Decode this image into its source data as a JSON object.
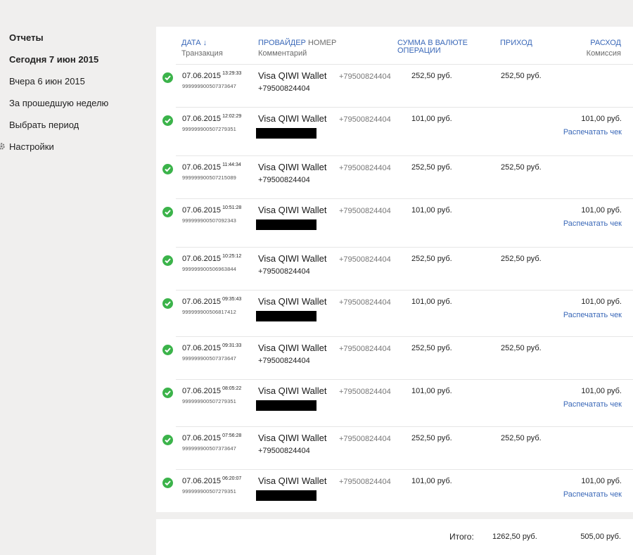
{
  "sidebar": {
    "items": [
      {
        "label": "Отчеты"
      },
      {
        "label": "Сегодня 7 июн 2015"
      },
      {
        "label": "Вчера 6 июн 2015"
      },
      {
        "label": "За прошедшую неделю"
      },
      {
        "label": "Выбрать период"
      },
      {
        "label": "Настройки",
        "icon": "gear-icon"
      }
    ]
  },
  "table": {
    "headers": {
      "date": "ДАТА ↓",
      "transaction": "Транзакция",
      "provider": "ПРОВАЙДЕР",
      "number": "НОМЕР",
      "comment": "Комментарий",
      "amount_line1": "СУММА В ВАЛЮТЕ",
      "amount_line2": "ОПЕРАЦИИ",
      "income": "ПРИХОД",
      "expense": "РАСХОД",
      "commission": "Комиссия"
    },
    "rows": [
      {
        "date": "07.06.2015",
        "time": "13:29:33",
        "txid": "99999990050737364​7",
        "provider": "Visa QIWI Wallet",
        "number": "+79500824404",
        "comment": "+79500824404",
        "amount": "252,50 руб.",
        "income": "252,50 руб.",
        "expense": "",
        "print": ""
      },
      {
        "date": "07.06.2015",
        "time": "12:02:29",
        "txid": "999999900507279351",
        "provider": "Visa QIWI Wallet",
        "number": "+79500824404",
        "comment": "",
        "amount": "101,00 руб.",
        "income": "",
        "expense": "101,00 руб.",
        "print": "Распечатать чек"
      },
      {
        "date": "07.06.2015",
        "time": "11:44:34",
        "txid": "999999900507215089",
        "provider": "Visa QIWI Wallet",
        "number": "+79500824404",
        "comment": "+79500824404",
        "amount": "252,50 руб.",
        "income": "252,50 руб.",
        "expense": "",
        "print": ""
      },
      {
        "date": "07.06.2015",
        "time": "10:51:28",
        "txid": "999999900507092343",
        "provider": "Visa QIWI Wallet",
        "number": "+79500824404",
        "comment": "",
        "amount": "101,00 руб.",
        "income": "",
        "expense": "101,00 руб.",
        "print": "Распечатать чек"
      },
      {
        "date": "07.06.2015",
        "time": "10:25:12",
        "txid": "999999900506963844",
        "provider": "Visa QIWI Wallet",
        "number": "+79500824404",
        "comment": "+79500824404",
        "amount": "252,50 руб.",
        "income": "252,50 руб.",
        "expense": "",
        "print": ""
      },
      {
        "date": "07.06.2015",
        "time": "09:35:43",
        "txid": "999999900506817412",
        "provider": "Visa QIWI Wallet",
        "number": "+79500824404",
        "comment": "",
        "amount": "101,00 руб.",
        "income": "",
        "expense": "101,00 руб.",
        "print": "Распечатать чек"
      },
      {
        "date": "07.06.2015",
        "time": "09:31:33",
        "txid": "999999900507373647",
        "provider": "Visa QIWI Wallet",
        "number": "+79500824404",
        "comment": "+79500824404",
        "amount": "252,50 руб.",
        "income": "252,50 руб.",
        "expense": "",
        "print": ""
      },
      {
        "date": "07.06.2015",
        "time": "08:05:22",
        "txid": "999999900507279351",
        "provider": "Visa QIWI Wallet",
        "number": "+79500824404",
        "comment": "",
        "amount": "101,00 руб.",
        "income": "",
        "expense": "101,00 руб.",
        "print": "Распечатать чек"
      },
      {
        "date": "07.06.2015",
        "time": "07:56:28",
        "txid": "999999900507373647",
        "provider": "Visa QIWI Wallet",
        "number": "+79500824404",
        "comment": "+79500824404",
        "amount": "252,50 руб.",
        "income": "252,50 руб.",
        "expense": "",
        "print": ""
      },
      {
        "date": "07.06.2015",
        "time": "06:20:07",
        "txid": "999999900507279351",
        "provider": "Visa QIWI Wallet",
        "number": "+79500824404",
        "comment": "",
        "amount": "101,00 руб.",
        "income": "",
        "expense": "101,00 руб.",
        "print": "Распечатать чек"
      }
    ]
  },
  "totals": {
    "label": "Итого:",
    "income": "1262,50 руб.",
    "expense": "505,00 руб."
  },
  "colors": {
    "accent": "#3a68b8",
    "success": "#3bb34a",
    "background": "#f0efee"
  }
}
